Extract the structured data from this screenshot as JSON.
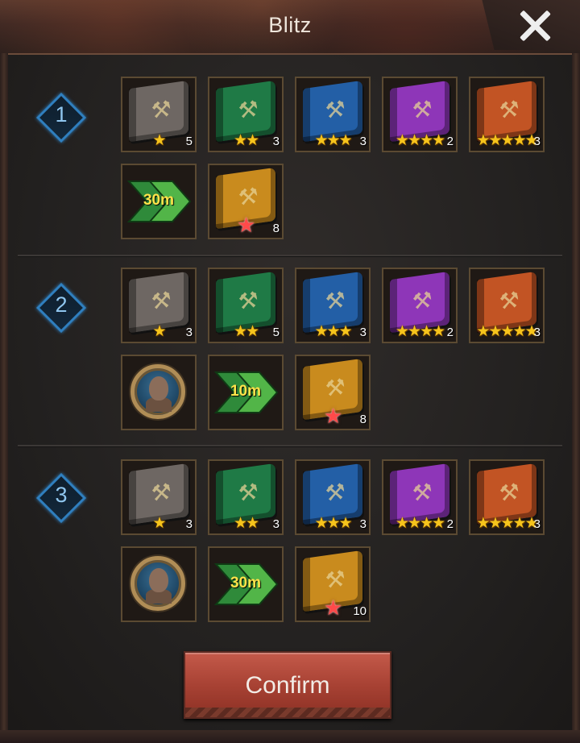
{
  "window": {
    "title": "Blitz",
    "close_icon": "close-icon"
  },
  "colors": {
    "book_grey": "#6e6763",
    "book_green": "#1f7a46",
    "book_blue": "#235fa6",
    "book_purple": "#8e36b8",
    "book_orange": "#c25424",
    "book_gold": "#c98b1e",
    "badge_border": "#2f7fbf",
    "star_gold": "#f6c41c",
    "star_red": "#ff4a4a"
  },
  "rows": [
    {
      "number": "1",
      "items": [
        {
          "type": "book",
          "color": "grey",
          "stars": "★",
          "count": "5"
        },
        {
          "type": "book",
          "color": "green",
          "stars": "★★",
          "count": "3"
        },
        {
          "type": "book",
          "color": "blue",
          "stars": "★★★",
          "count": "3"
        },
        {
          "type": "book",
          "color": "purple",
          "stars": "★★★★",
          "count": "2"
        },
        {
          "type": "book",
          "color": "orange",
          "stars": "★★★★★",
          "count": "3"
        },
        {
          "type": "speedup",
          "label": "30m"
        },
        {
          "type": "book-red-star",
          "color": "gold",
          "count": "8"
        }
      ]
    },
    {
      "number": "2",
      "items": [
        {
          "type": "book",
          "color": "grey",
          "stars": "★",
          "count": "3"
        },
        {
          "type": "book",
          "color": "green",
          "stars": "★★",
          "count": "5"
        },
        {
          "type": "book",
          "color": "blue",
          "stars": "★★★",
          "count": "3"
        },
        {
          "type": "book",
          "color": "purple",
          "stars": "★★★★",
          "count": "2"
        },
        {
          "type": "book",
          "color": "orange",
          "stars": "★★★★★",
          "count": "3"
        },
        {
          "type": "medal"
        },
        {
          "type": "speedup",
          "label": "10m"
        },
        {
          "type": "book-red-star",
          "color": "gold",
          "count": "8"
        }
      ]
    },
    {
      "number": "3",
      "items": [
        {
          "type": "book",
          "color": "grey",
          "stars": "★",
          "count": "3"
        },
        {
          "type": "book",
          "color": "green",
          "stars": "★★",
          "count": "3"
        },
        {
          "type": "book",
          "color": "blue",
          "stars": "★★★",
          "count": "3"
        },
        {
          "type": "book",
          "color": "purple",
          "stars": "★★★★",
          "count": "2"
        },
        {
          "type": "book",
          "color": "orange",
          "stars": "★★★★★",
          "count": "3"
        },
        {
          "type": "medal"
        },
        {
          "type": "speedup",
          "label": "30m"
        },
        {
          "type": "book-red-star",
          "color": "gold",
          "count": "10"
        }
      ]
    }
  ],
  "confirm": {
    "label": "Confirm"
  }
}
